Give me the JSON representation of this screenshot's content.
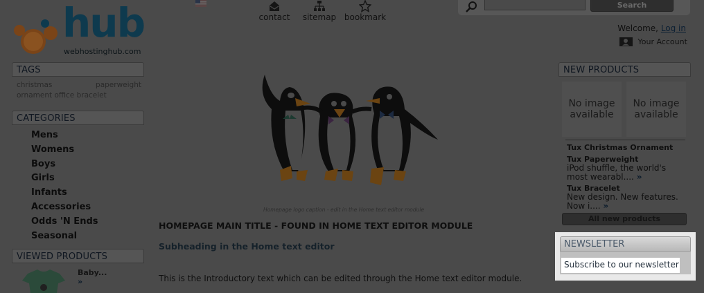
{
  "header": {
    "logo_word": "hub",
    "logo_domain": "webhostinghub.com",
    "links": [
      {
        "label": "contact",
        "icon": "envelope-icon"
      },
      {
        "label": "sitemap",
        "icon": "sitemap-icon"
      },
      {
        "label": "bookmark",
        "icon": "star-icon"
      }
    ],
    "search": {
      "button_label": "Search",
      "value": ""
    },
    "welcome_text": "Welcome,",
    "login_label": "Log in",
    "account_label": "Your Account"
  },
  "tags": {
    "title": "TAGS",
    "items": [
      "christmas",
      "paperweight",
      "ornament",
      "office",
      "bracelet"
    ]
  },
  "categories": {
    "title": "CATEGORIES",
    "items": [
      "Mens",
      "Womens",
      "Boys",
      "Girls",
      "Infants",
      "Accessories",
      "Odds 'N Ends",
      "Seasonal"
    ]
  },
  "viewed": {
    "title": "VIEWED PRODUCTS",
    "item_name": "Baby...",
    "arrow": "»"
  },
  "main": {
    "caption": "Homepage logo caption - edit in the Home text editor module",
    "title": "HOMEPAGE MAIN TITLE - FOUND IN HOME TEXT EDITOR MODULE",
    "subheading": "Subheading in the Home text editor",
    "intro": "This is the Introductory text which can be edited through the Home text editor module."
  },
  "new_products": {
    "title": "NEW PRODUCTS",
    "no_image": [
      "No image available",
      "No image available"
    ],
    "items": [
      {
        "name": "Tux Christmas Ornament",
        "desc": ""
      },
      {
        "name": "Tux Paperweight",
        "desc": "iPod shuffle, the world's most wearabl....",
        "arrow": "»"
      },
      {
        "name": "Tux Bracelet",
        "desc": "New design. New features. Now i....",
        "arrow": "»"
      }
    ],
    "all_button": "All new products"
  },
  "newsletter": {
    "title": "NEWSLETTER",
    "link": "Subscribe to our newsletter"
  },
  "colors": {
    "overlay_bg": "#4a4a4a",
    "logo_blue": "#0e3a4e",
    "logo_orange": "#b8692a",
    "highlight": "#e9e9e9"
  }
}
